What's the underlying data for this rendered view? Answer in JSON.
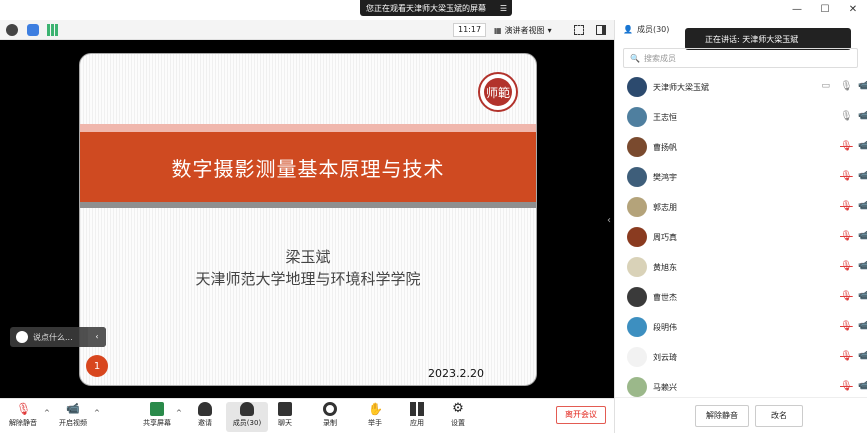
{
  "banner": {
    "text": "您正在观看天津师大梁玉斌的屏幕",
    "menu_icon": "menu-icon"
  },
  "window": {
    "minimize": "—",
    "maximize": "☐",
    "close": "✕"
  },
  "toolbar": {
    "time": "11:17",
    "view_label": "演讲者视图",
    "view_caret": "▾"
  },
  "slide": {
    "logo_char": "师範",
    "title": "数字摄影测量基本原理与技术",
    "author": "梁玉斌",
    "school": "天津师范大学地理与环境科学学院",
    "date": "2023.2.20",
    "page": "1"
  },
  "chat": {
    "placeholder": "说点什么...",
    "collapse": "‹"
  },
  "bottom": {
    "mute": "解除静音",
    "video": "开启视频",
    "share": "共享屏幕",
    "invite": "邀请",
    "members": "成员(30)",
    "chat": "聊天",
    "record": "录制",
    "raise": "举手",
    "apps": "应用",
    "settings": "设置",
    "leave": "离开会议",
    "caret": "^"
  },
  "panel": {
    "title": "成员(30)",
    "speaking": "正在讲话: 天津师大梁玉斌",
    "search_placeholder": "搜索成员",
    "members": [
      {
        "name": "天津师大梁玉斌",
        "muted": false,
        "sharing": true,
        "color": "#2c4a6e"
      },
      {
        "name": "王志恒",
        "muted": false,
        "sharing": false,
        "color": "#4f7f9f"
      },
      {
        "name": "曹扬帆",
        "muted": true,
        "sharing": false,
        "color": "#7a4a2e"
      },
      {
        "name": "樊鸿宇",
        "muted": true,
        "sharing": false,
        "color": "#3e5e7a"
      },
      {
        "name": "郭志朋",
        "muted": true,
        "sharing": false,
        "color": "#b4a37a"
      },
      {
        "name": "周巧真",
        "muted": true,
        "sharing": false,
        "color": "#8a3b20"
      },
      {
        "name": "黄旭东",
        "muted": true,
        "sharing": false,
        "color": "#d9d2b8"
      },
      {
        "name": "曹世杰",
        "muted": true,
        "sharing": false,
        "color": "#3a3a3a"
      },
      {
        "name": "段明伟",
        "muted": true,
        "sharing": false,
        "color": "#3d8fc0"
      },
      {
        "name": "刘云琦",
        "muted": true,
        "sharing": false,
        "color": "#f2f2f2"
      },
      {
        "name": "马赖兴",
        "muted": true,
        "sharing": false,
        "color": "#9bb88a"
      }
    ],
    "mute_all": "解除静音",
    "rename": "改名"
  },
  "colors": {
    "accent_red": "#cf4a21",
    "leave_red": "#e2231a"
  }
}
